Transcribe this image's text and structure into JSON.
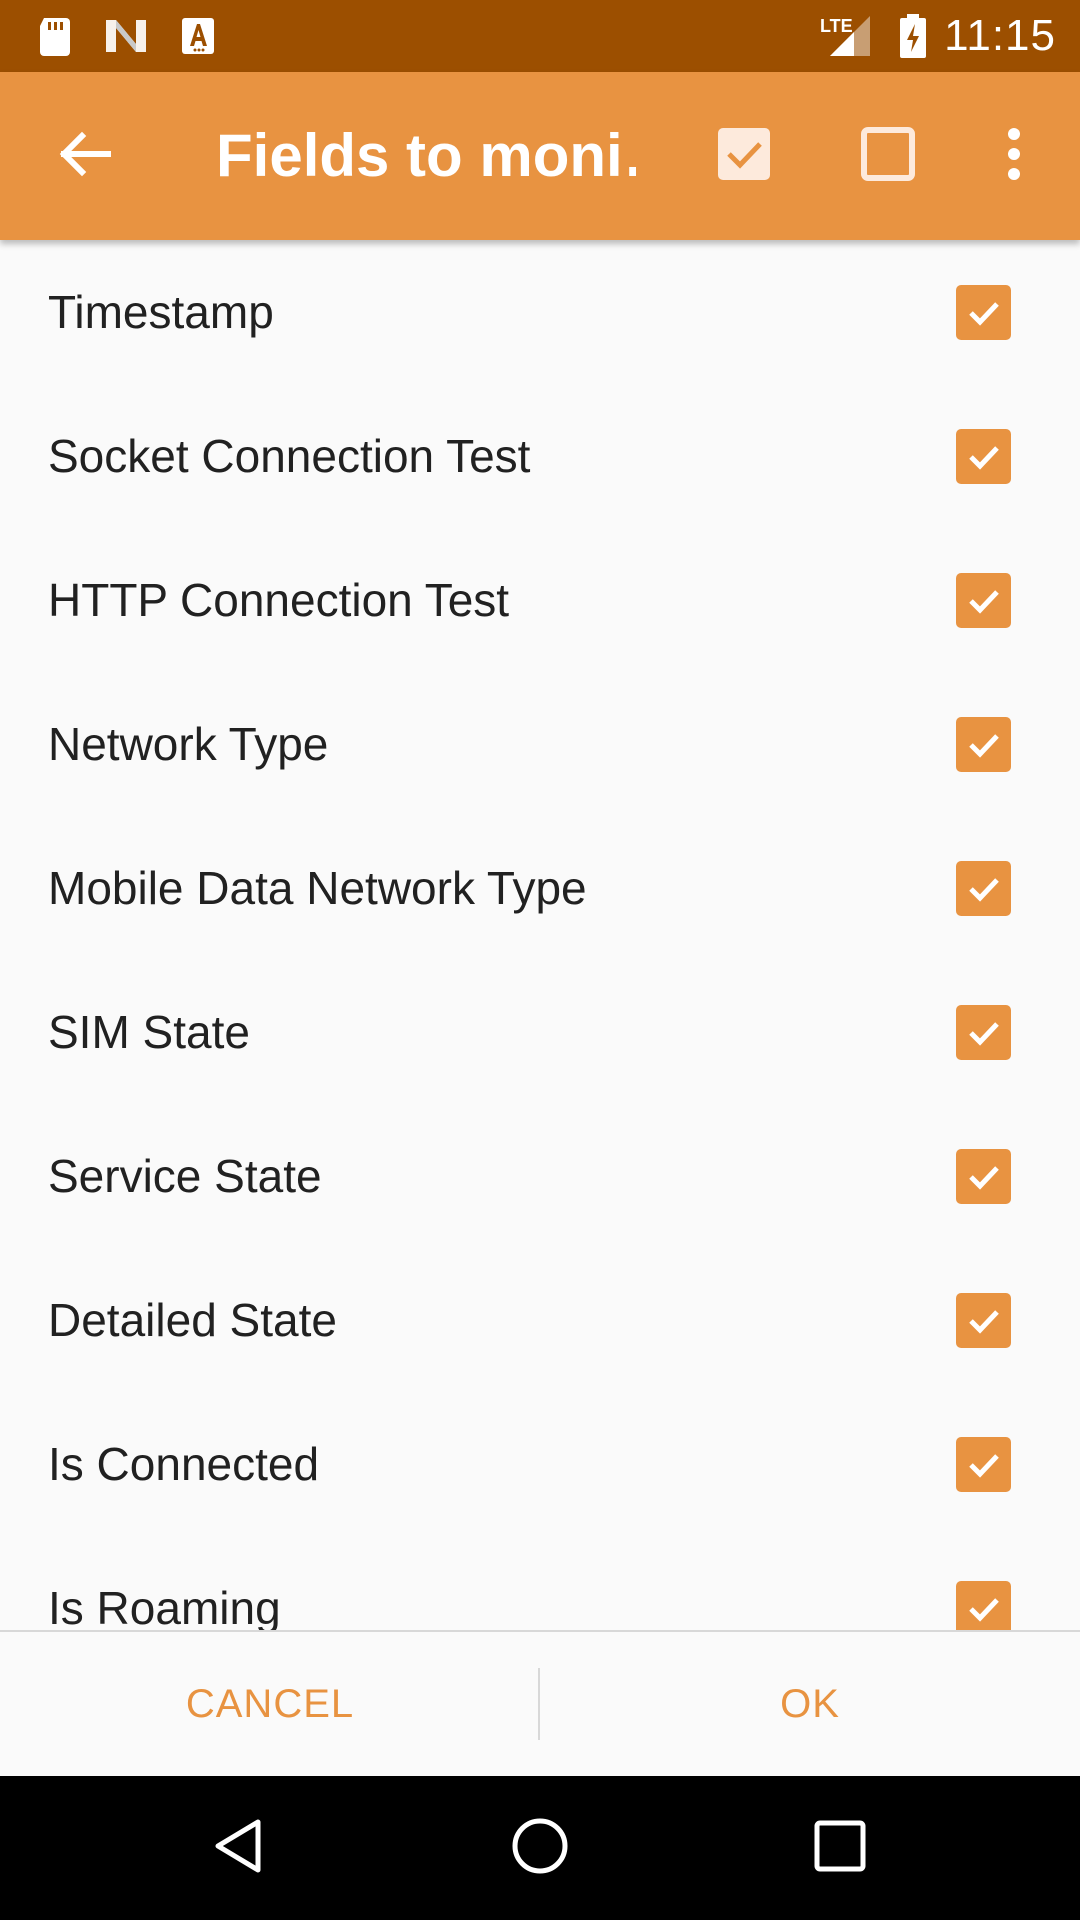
{
  "status_bar": {
    "time": "11:15",
    "icons": [
      "sd-card-icon",
      "n-notification-icon",
      "a-notification-icon",
      "lte-signal-icon",
      "battery-charging-icon"
    ],
    "lte_label": "LTE",
    "background": "#9c4f00"
  },
  "app_bar": {
    "title": "Fields to moni…",
    "background": "#e89341",
    "actions": [
      "back-arrow-icon",
      "select-all-icon",
      "deselect-all-icon",
      "overflow-menu-icon"
    ]
  },
  "fields": [
    {
      "label": "Timestamp",
      "checked": true
    },
    {
      "label": "Socket Connection Test",
      "checked": true
    },
    {
      "label": "HTTP Connection Test",
      "checked": true
    },
    {
      "label": "Network Type",
      "checked": true
    },
    {
      "label": "Mobile Data Network Type",
      "checked": true
    },
    {
      "label": "SIM State",
      "checked": true
    },
    {
      "label": "Service State",
      "checked": true
    },
    {
      "label": "Detailed State",
      "checked": true
    },
    {
      "label": "Is Connected",
      "checked": true
    },
    {
      "label": "Is Roaming",
      "checked": true
    }
  ],
  "dialog": {
    "cancel_label": "CANCEL",
    "ok_label": "OK"
  },
  "nav_bar": {
    "icons": [
      "back-nav-icon",
      "home-nav-icon",
      "recents-nav-icon"
    ]
  },
  "colors": {
    "accent": "#e89341",
    "text": "#212121",
    "background": "#fafafa"
  }
}
